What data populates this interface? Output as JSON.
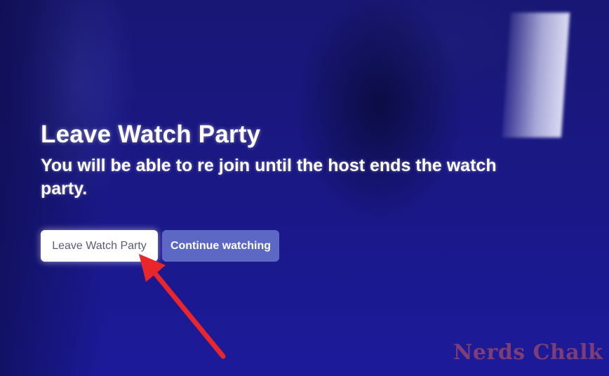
{
  "dialog": {
    "title": "Leave Watch Party",
    "message": "You will be able to re join until the host ends the watch party."
  },
  "buttons": {
    "leave_label": "Leave Watch Party",
    "continue_label": "Continue watching"
  },
  "watermark": {
    "text": "Nerds Chalk"
  },
  "colors": {
    "background": "#1a1887",
    "accent_button": "#5c68c4",
    "annotation_arrow": "#e8262b"
  }
}
